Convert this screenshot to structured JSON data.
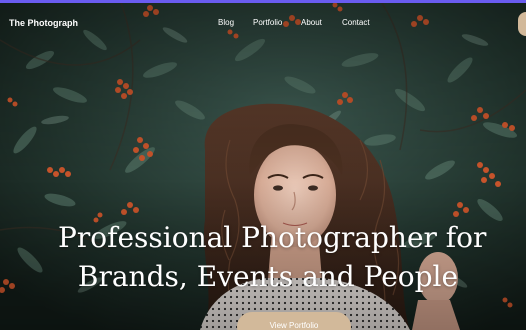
{
  "nav": {
    "brand": "The Photograph",
    "links": [
      "Blog",
      "Portfolio",
      "About",
      "Contact"
    ]
  },
  "hero": {
    "headline_line1": "Professional Photographer for",
    "headline_line2": "Brands, Events and People",
    "cta_label": "View Portfolio"
  },
  "colors": {
    "accent_bar": "#6a5cf0",
    "cta_background": "#d2b99a",
    "text": "#ffffff"
  }
}
